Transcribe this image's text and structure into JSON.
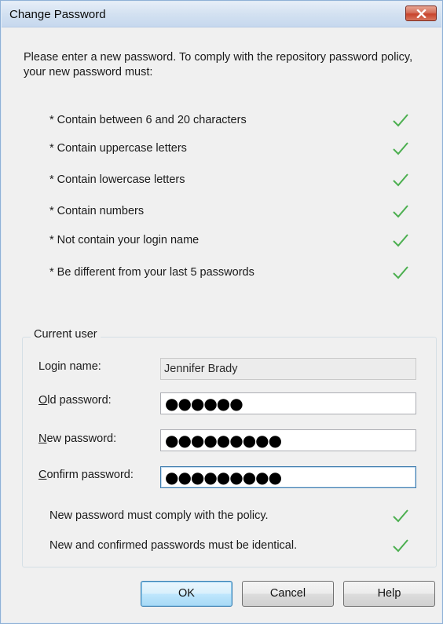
{
  "window": {
    "title": "Change Password"
  },
  "intro": "Please enter a new password. To comply with the repository password policy, your new password must:",
  "policy_rules": [
    {
      "text": "* Contain between 6 and 20 characters",
      "met": true
    },
    {
      "text": "* Contain uppercase letters",
      "met": true
    },
    {
      "text": "* Contain lowercase letters",
      "met": true
    },
    {
      "text": "* Contain numbers",
      "met": true
    },
    {
      "text": "* Not contain your login name",
      "met": true
    },
    {
      "text": "* Be different from your last 5 passwords",
      "met": true
    }
  ],
  "current_user": {
    "legend": "Current user",
    "login_label": "Login name:",
    "login_value": "Jennifer Brady",
    "old_label_key": "O",
    "old_label_rest": "ld password:",
    "old_value": "●●●●●●",
    "new_label_key": "N",
    "new_label_rest": "ew password:",
    "new_value": "●●●●●●●●●",
    "confirm_label_key": "C",
    "confirm_label_rest": "onfirm password:",
    "confirm_value": "●●●●●●●●●"
  },
  "validation": [
    {
      "text": "New password must comply with the policy.",
      "met": true
    },
    {
      "text": "New and confirmed passwords must be identical.",
      "met": true
    }
  ],
  "buttons": {
    "ok": "OK",
    "cancel": "Cancel",
    "help": "Help"
  },
  "colors": {
    "check": "#4caf50",
    "close": "#c8442c"
  },
  "icons": {
    "check": "checkmark-icon",
    "close": "close-icon"
  }
}
